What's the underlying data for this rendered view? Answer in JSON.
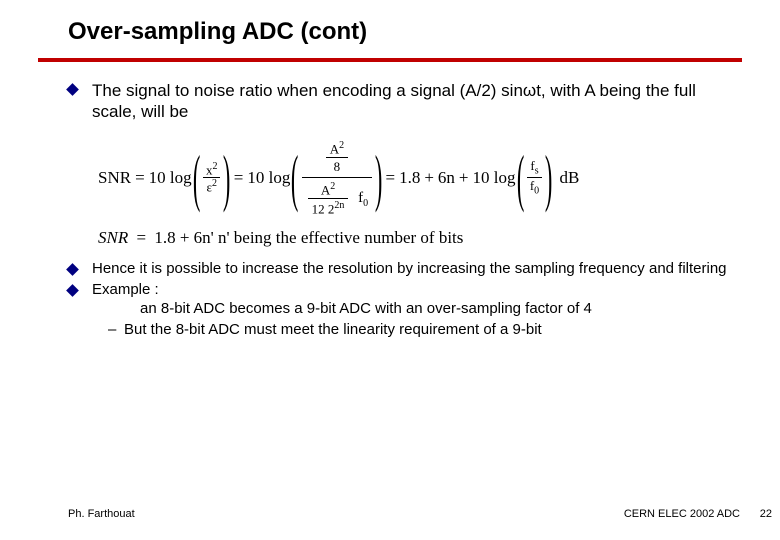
{
  "title": "Over-sampling ADC (cont)",
  "bullet1_a": "The signal to noise ratio when encoding a signal (A/2) sin",
  "bullet1_b": "t, with A being the full scale, will be",
  "omega": "ω",
  "formula": {
    "snr": "SNR",
    "eq": "=",
    "plus": "+",
    "tenlog": "10 log",
    "x2": "x",
    "e2": "ε",
    "A2": "A",
    "sq": "2",
    "eight": "8",
    "twelve": "12 2",
    "exp2n": "2n",
    "f0": "f",
    "zero": "0",
    "const": "1.8",
    "sixn": "6n",
    "fs": "f",
    "s": "s",
    "db": "dB",
    "row2": "1.8 + 6n'  n'  being the effective number of bits"
  },
  "bullet2": "Hence it is possible to increase the resolution by increasing the sampling frequency and filtering",
  "bullet3": "Example :",
  "bullet3_line2": "an 8-bit ADC becomes a 9-bit ADC with an over-sampling factor of 4",
  "sub1": "But the 8-bit ADC must meet the linearity requirement of a 9-bit",
  "footer": {
    "left": "Ph. Farthouat",
    "right": "CERN ELEC 2002 ADC",
    "page": "22"
  }
}
